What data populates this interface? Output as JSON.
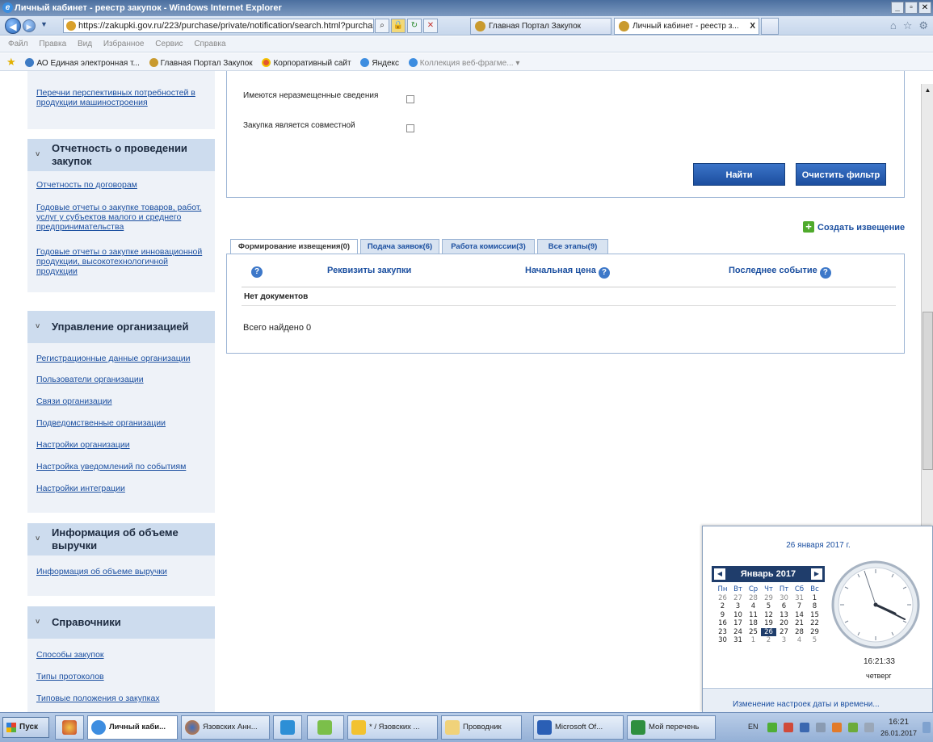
{
  "window": {
    "title": "Личный кабинет - реестр закупок - Windows Internet Explorer"
  },
  "browser": {
    "url": "https://zakupki.gov.ru/223/purchase/private/notification/search.html?purchaseStages:",
    "tabs": [
      {
        "label": "Главная Портал Закупок"
      },
      {
        "label": "Личный кабинет - реестр з...",
        "close": "X"
      }
    ]
  },
  "menu": {
    "items": [
      "Файл",
      "Правка",
      "Вид",
      "Избранное",
      "Сервис",
      "Справка"
    ]
  },
  "favorites": [
    "АО Единая электронная т...",
    "Главная Портал Закупок",
    "Корпоративный сайт",
    "Яндекс",
    "Коллекция веб-фрагме..."
  ],
  "sidebar": {
    "top_link": "Перечни перспективных потребностей в продукции машиностроения",
    "sections": [
      {
        "title": "Отчетность о проведении закупок",
        "links": [
          "Отчетность по договорам",
          "Годовые отчеты о закупке товаров, работ, услуг у субъектов малого и среднего предпринимательства",
          "Годовые отчеты о закупке инновационной продукции, высокотехнологичной продукции"
        ]
      },
      {
        "title": "Управление организацией",
        "links": [
          "Регистрационные данные организации",
          "Пользователи организации",
          "Связи организации",
          "Подведомственные организации",
          "Настройки организации",
          "Настройка уведомлений по событиям",
          "Настройки интеграции"
        ]
      },
      {
        "title": "Информация об объеме выручки",
        "links": [
          "Информация об объеме выручки"
        ]
      },
      {
        "title": "Справочники",
        "links": [
          "Способы закупок",
          "Типы протоколов",
          "Типовые положения о закупках"
        ]
      }
    ]
  },
  "filter": {
    "checkbox_unplaced": "Имеются неразмещенные сведения",
    "checkbox_joint": "Закупка является совместной",
    "find_button": "Найти",
    "clear_button": "Очистить фильтр"
  },
  "create_notice": "Создать извещение",
  "stage_tabs": [
    "Формирование извещения(0)",
    "Подача заявок(6)",
    "Работа комиссии(3)",
    "Все этапы(9)"
  ],
  "results": {
    "col_requisites": "Реквизиты закупки",
    "col_price": "Начальная цена",
    "col_last_event": "Последнее событие",
    "empty_text": "Нет документов",
    "total": "Всего найдено 0"
  },
  "calendar": {
    "long_date": "26 января 2017 г.",
    "month_label": "Январь 2017",
    "weekdays": [
      "Пн",
      "Вт",
      "Ср",
      "Чт",
      "Пт",
      "Сб",
      "Вс"
    ],
    "weeks": [
      [
        "26",
        "27",
        "28",
        "29",
        "30",
        "31",
        "1"
      ],
      [
        "2",
        "3",
        "4",
        "5",
        "6",
        "7",
        "8"
      ],
      [
        "9",
        "10",
        "11",
        "12",
        "13",
        "14",
        "15"
      ],
      [
        "16",
        "17",
        "18",
        "19",
        "20",
        "21",
        "22"
      ],
      [
        "23",
        "24",
        "25",
        "26",
        "27",
        "28",
        "29"
      ],
      [
        "30",
        "31",
        "1",
        "2",
        "3",
        "4",
        "5"
      ]
    ],
    "selected": "26",
    "time": "16:21:33",
    "weekday_name": "четверг",
    "settings_link": "Изменение настроек даты и времени..."
  },
  "taskbar": {
    "start": "Пуск",
    "items": [
      "Личный каби...",
      "Язовских Анн...",
      "* / Язовских ...",
      "Проводник",
      "Microsoft Of...",
      "Мой перечень"
    ],
    "lang": "EN",
    "clock_time": "16:21",
    "clock_date": "26.01.2017"
  }
}
